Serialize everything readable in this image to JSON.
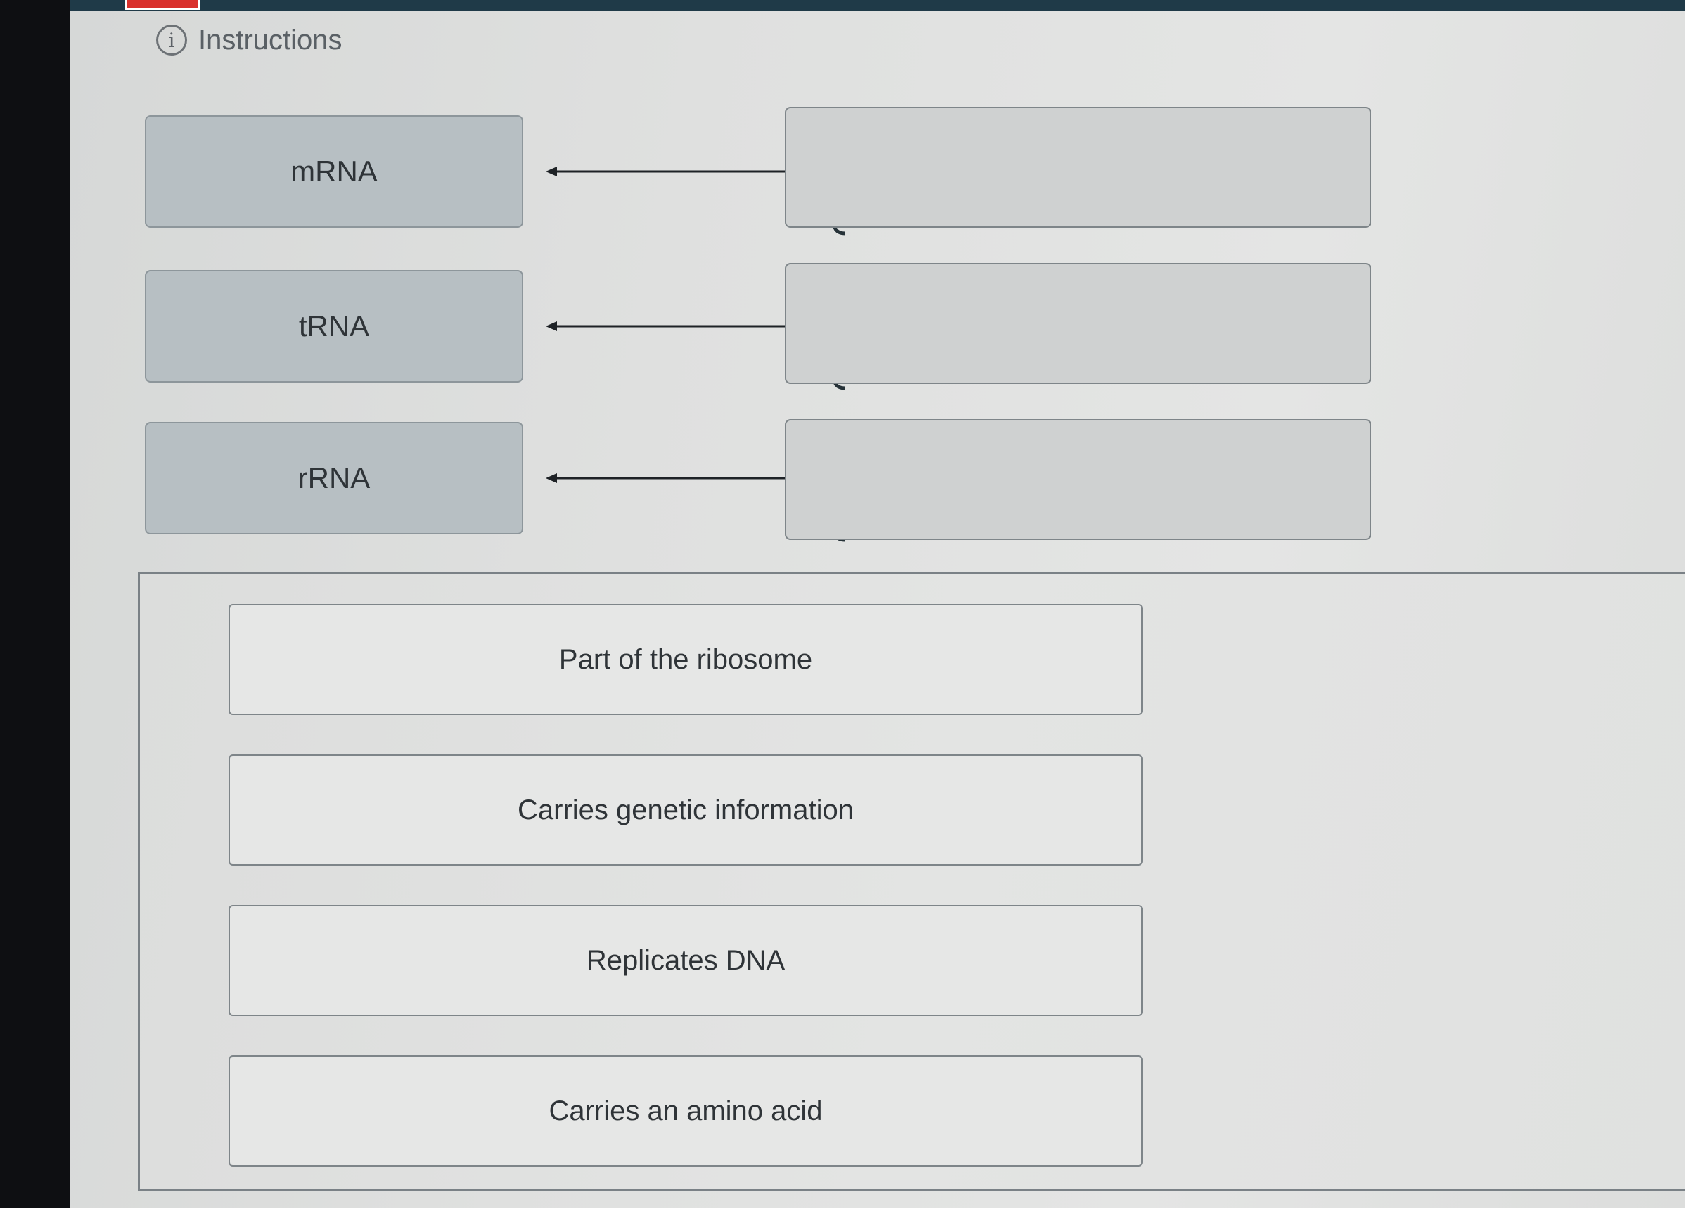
{
  "header": {
    "instructions_label": "Instructions"
  },
  "terms": [
    {
      "label": "mRNA"
    },
    {
      "label": "tRNA"
    },
    {
      "label": "rRNA"
    }
  ],
  "choices": [
    {
      "label": "Part of the ribosome"
    },
    {
      "label": "Carries genetic information"
    },
    {
      "label": "Replicates DNA"
    },
    {
      "label": "Carries an amino acid"
    }
  ],
  "colors": {
    "top_bar": "#1f3a48",
    "accent": "#d9302b",
    "term_fill": "#b7bfc3",
    "drop_zone_fill": "#cfd1d1"
  },
  "icons": {
    "instructions": "info-icon",
    "connector": "double-arrow-icon",
    "bracket": "left-brace-icon"
  }
}
